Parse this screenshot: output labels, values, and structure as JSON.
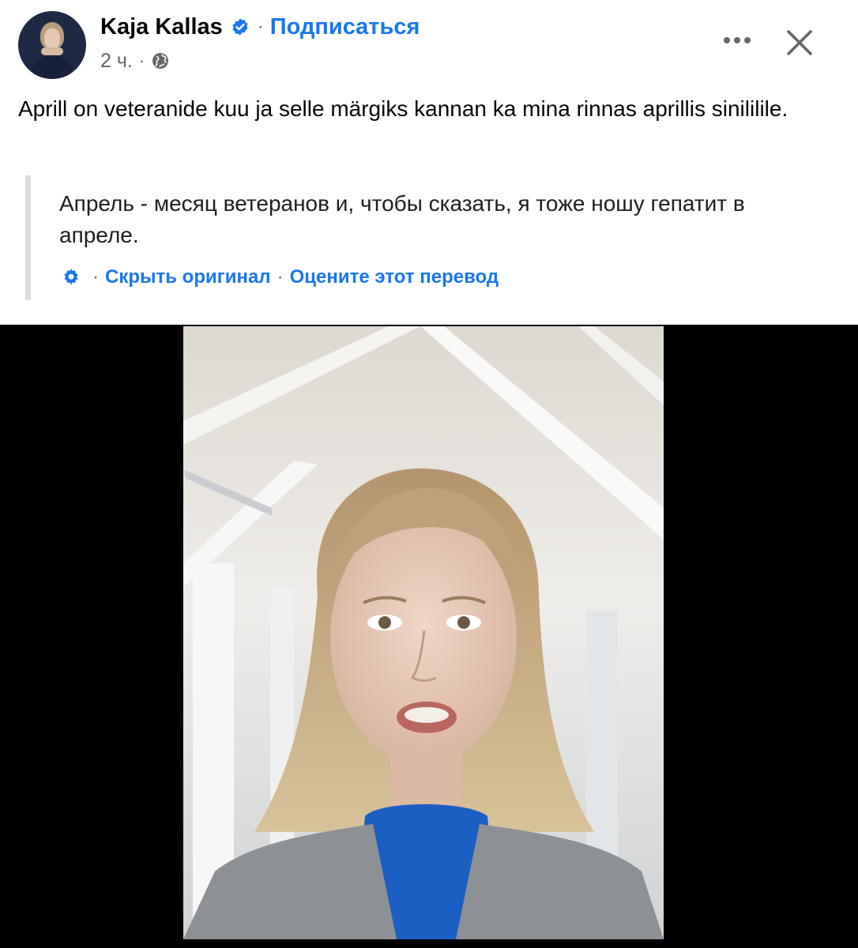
{
  "post": {
    "author": "Kaja Kallas",
    "subscribe_label": "Подписаться",
    "time": "2 ч.",
    "original_text": "Aprill on veteranide kuu ja selle märgiks kannan ka mina rinnas aprillis sinililile.",
    "translated_text": "Апрель - месяц ветеранов и, чтобы сказать, я тоже ношу гепатит в апреле.",
    "hide_original_label": "Скрыть оригинал",
    "rate_translation_label": "Оцените этот перевод"
  },
  "icons": {
    "verified": "verified-badge-icon",
    "privacy": "globe-icon",
    "more": "more-horizontal-icon",
    "close": "close-icon",
    "settings": "gear-icon"
  },
  "colors": {
    "link": "#1877f2",
    "meta": "#65676b",
    "quote_bar": "#dadde1",
    "video_bg": "#000000"
  }
}
